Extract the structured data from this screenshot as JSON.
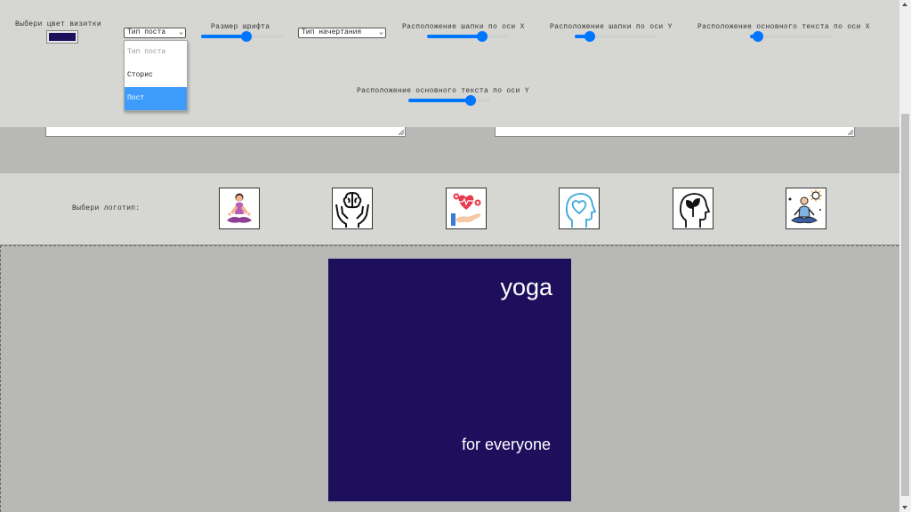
{
  "controls": {
    "card_color_label": "Выбери цвет визитки",
    "card_color_value": "#1e0f5c",
    "post_type_select": {
      "selected": "Тип поста",
      "options": [
        "Тип поста",
        "Сторис",
        "Пост"
      ],
      "highlighted": "Пост"
    },
    "font_size_label": "Размер шрифта",
    "font_size_value": 0.55,
    "font_style_select": {
      "selected": "Тип начертания"
    },
    "header_x_label": "Расположение шапки по оси X",
    "header_x_value": 0.67,
    "header_y_label": "Расположение шапки по оси Y",
    "header_y_value": 0.18,
    "body_x_label": "Расположение основного текста по оси X",
    "body_x_value": 0.1,
    "body_y_label": "Расположение основного текста по оси Y",
    "body_y_value": 0.76
  },
  "logos": {
    "label": "Выбери логотип:",
    "items": [
      "yoga-woman-icon",
      "brain-hands-icon",
      "heart-care-hand-icon",
      "head-heart-icon",
      "head-plant-icon",
      "meditation-sun-icon"
    ]
  },
  "preview": {
    "background": "#1e0f5c",
    "title": "yoga",
    "subtitle": "for everyone"
  },
  "colors": {
    "accent": "#0075ff",
    "highlight": "#3c9bfb",
    "panel": "#d6d6d3",
    "workspace": "#b8b8b6"
  }
}
